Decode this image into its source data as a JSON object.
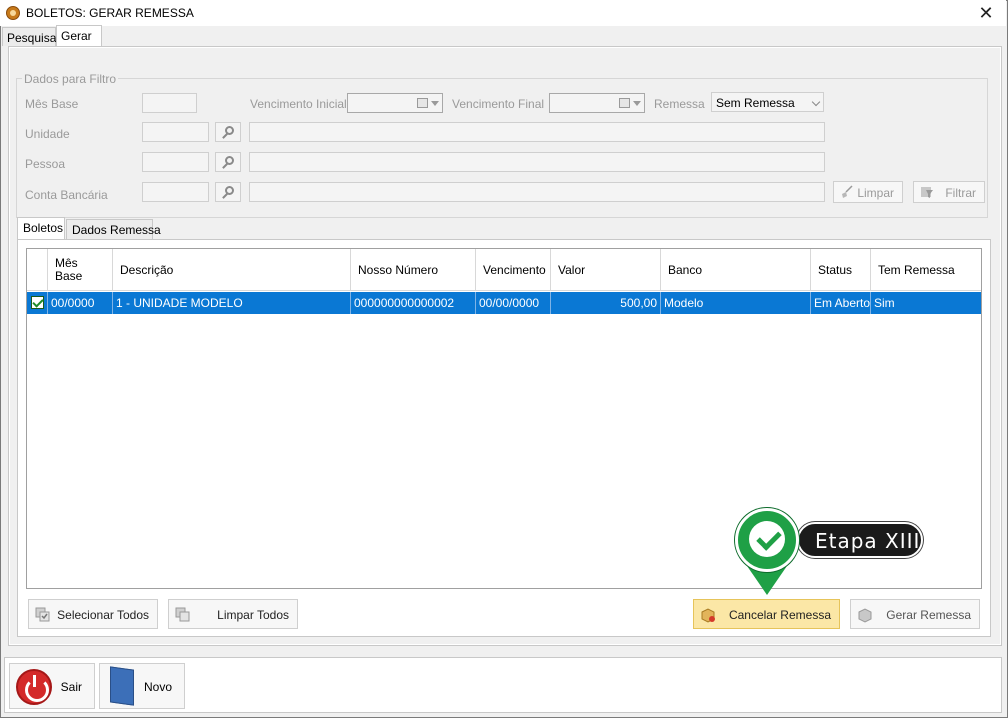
{
  "window": {
    "title": "BOLETOS: GERAR REMESSA",
    "close_glyph": "✕"
  },
  "top_tabs": [
    "Pesquisa",
    "Gerar"
  ],
  "filter": {
    "legend": "Dados para Filtro",
    "mes_base_label": "Mês Base",
    "vencimento_inicial_label": "Vencimento Inicial",
    "vencimento_final_label": "Vencimento Final",
    "remessa_label": "Remessa",
    "remessa_value": "Sem Remessa",
    "unidade_label": "Unidade",
    "pessoa_label": "Pessoa",
    "conta_label": "Conta Bancária",
    "limpar_label": "Limpar",
    "filtrar_label": "Filtrar"
  },
  "inner_tabs": [
    "Boletos",
    "Dados Remessa"
  ],
  "grid": {
    "columns": [
      "Mês\nBase",
      "Descrição",
      "Nosso Número",
      "Vencimento",
      "Valor",
      "Banco",
      "Status",
      "Tem Remessa"
    ],
    "rows": [
      {
        "checked": true,
        "mes_base": "00/0000",
        "descricao": "1 - UNIDADE MODELO",
        "nosso_numero": "000000000000002",
        "vencimento": "00/00/0000",
        "valor": "500,00",
        "banco": "Modelo",
        "status": "Em Aberto",
        "tem_remessa": "Sim"
      }
    ]
  },
  "actions": {
    "selecionar_todos": "Selecionar Todos",
    "limpar_todos": "Limpar Todos",
    "cancelar_remessa": "Cancelar Remessa",
    "gerar_remessa": "Gerar Remessa"
  },
  "callout": {
    "text": "Etapa XIII"
  },
  "bottom": {
    "sair": "Sair",
    "novo": "Novo"
  },
  "colors": {
    "selection": "#0a78d4",
    "highlight_button": "#fbe7a6",
    "callout_green": "#1fa046"
  }
}
